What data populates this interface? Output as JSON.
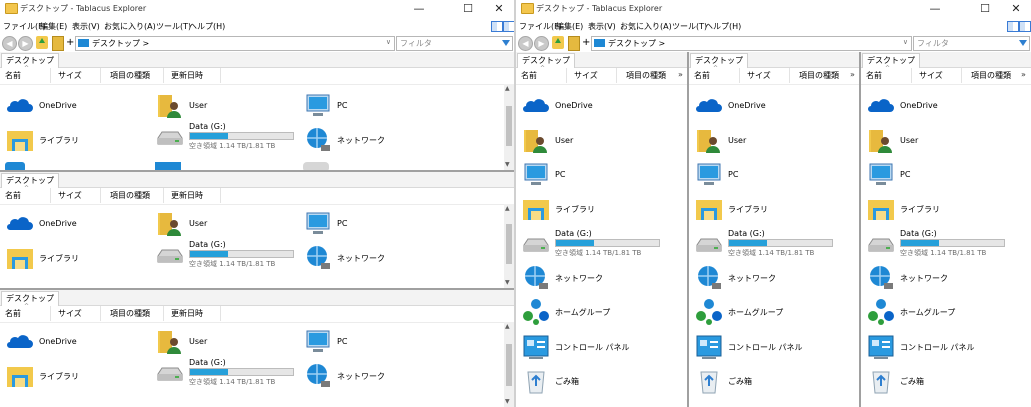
{
  "app": {
    "title": "デスクトップ - Tablacus Explorer",
    "window_controls": {
      "minimize": "—",
      "maximize": "☐",
      "close": "✕"
    }
  },
  "menu": [
    "ファイル(F)",
    "編集(E)",
    "表示(V)",
    "お気に入り(A)",
    "ツール(T)",
    "ヘルプ(H)"
  ],
  "toolbar": {
    "back_symbol": "◀",
    "forward_symbol": "▶",
    "plus": "+",
    "address_text": "デスクトップ >",
    "address_dropdown": "∨",
    "filter_placeholder": "フィルタ"
  },
  "tab_label": "デスクトップ",
  "columns": [
    "名前",
    "サイズ",
    "項目の種類",
    "更新日時"
  ],
  "more_columns": "»",
  "sort_caret": "^",
  "scroll": {
    "up": "▲",
    "down": "▼"
  },
  "items": {
    "onedrive": "OneDrive",
    "user": "User",
    "pc": "PC",
    "library": "ライブラリ",
    "network": "ネットワーク",
    "homegroup": "ホームグループ",
    "control_panel": "コントロール パネル",
    "recycle_bin": "ごみ箱",
    "drive": {
      "name": "Data (G:)",
      "free": "空き領域 1.14 TB/1.81 TB",
      "used_fraction": 0.37
    }
  },
  "colors": {
    "accent": "#1e88d4",
    "drive_bar": "#26a0da",
    "folder": "#f2c94c",
    "splitter": "#a0a0a0"
  }
}
